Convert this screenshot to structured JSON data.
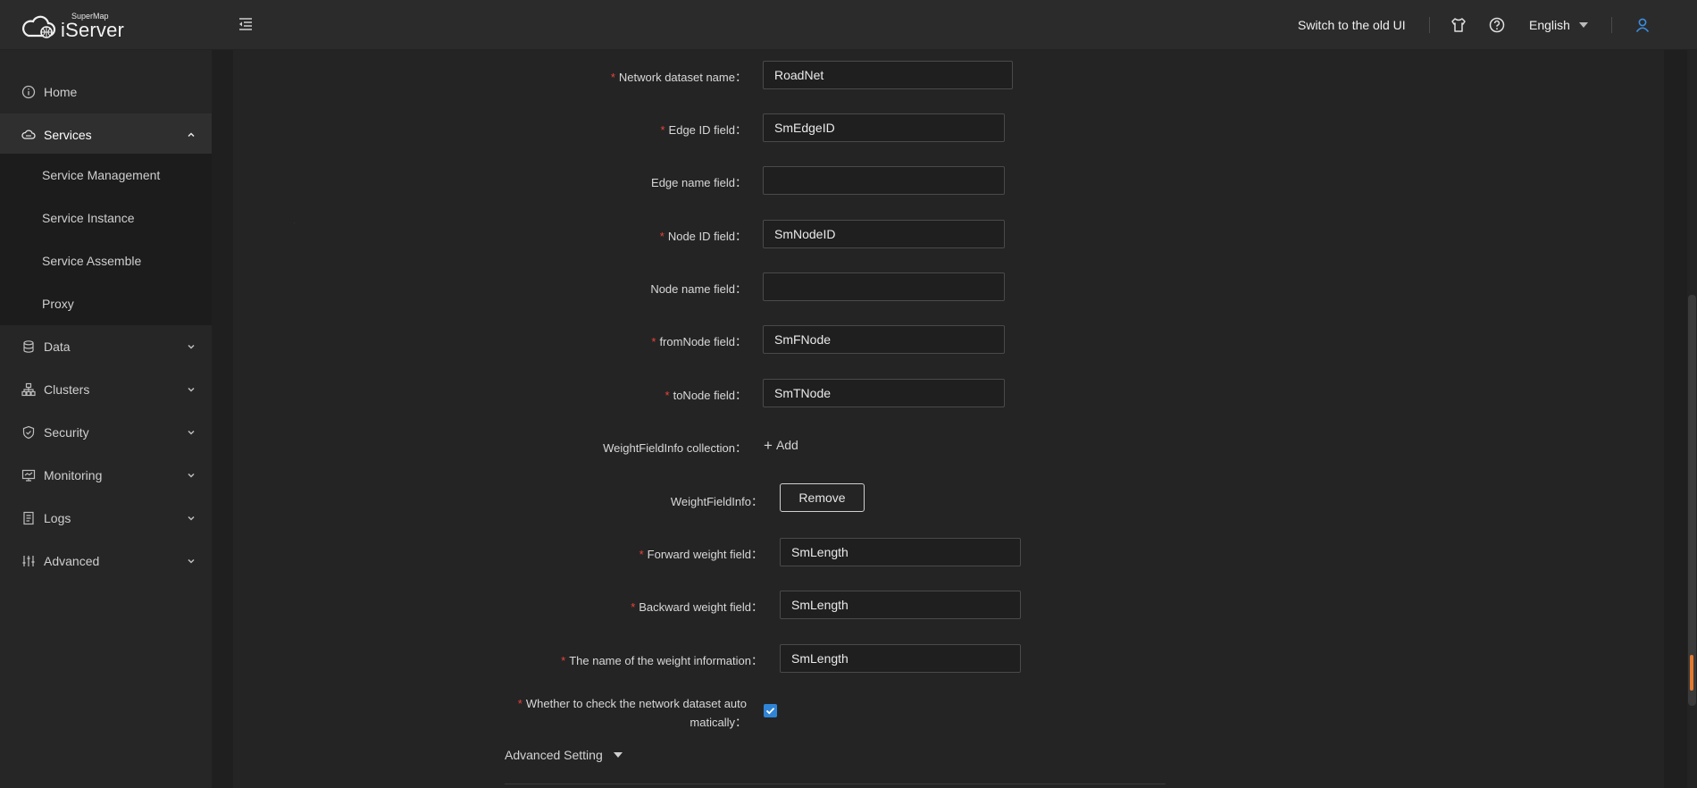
{
  "header": {
    "logo_small": "SuperMap",
    "logo_big": "iServer",
    "old_ui": "Switch to the old UI",
    "language": "English"
  },
  "sidebar": {
    "items": [
      {
        "label": "Home"
      },
      {
        "label": "Services"
      },
      {
        "label": "Data"
      },
      {
        "label": "Clusters"
      },
      {
        "label": "Security"
      },
      {
        "label": "Monitoring"
      },
      {
        "label": "Logs"
      },
      {
        "label": "Advanced"
      }
    ],
    "services_sub": [
      {
        "label": "Service Management"
      },
      {
        "label": "Service Instance"
      },
      {
        "label": "Service Assemble"
      },
      {
        "label": "Proxy"
      }
    ]
  },
  "form": {
    "network_dataset_name": {
      "label": "Network dataset name",
      "value": "RoadNet"
    },
    "edge_id_field": {
      "label": "Edge ID field",
      "value": "SmEdgeID"
    },
    "edge_name_field": {
      "label": "Edge name field",
      "value": ""
    },
    "node_id_field": {
      "label": "Node ID field",
      "value": "SmNodeID"
    },
    "node_name_field": {
      "label": "Node name field",
      "value": ""
    },
    "from_node_field": {
      "label": "fromNode field",
      "value": "SmFNode"
    },
    "to_node_field": {
      "label": "toNode field",
      "value": "SmTNode"
    },
    "weight_collection": {
      "label": "WeightFieldInfo collection",
      "add_label": "Add"
    },
    "weight_info": {
      "label": "WeightFieldInfo",
      "remove_label": "Remove"
    },
    "forward_weight_field": {
      "label": "Forward weight field",
      "value": "SmLength"
    },
    "backward_weight_field": {
      "label": "Backward weight field",
      "value": "SmLength"
    },
    "weight_info_name": {
      "label": "The name of the weight information",
      "value": "SmLength"
    },
    "auto_check": {
      "label_line1": "Whether to check the network dataset auto",
      "label_line2": "matically",
      "checked": true
    },
    "colon": "：",
    "required_mark": "*"
  },
  "advanced_setting": {
    "label": "Advanced Setting"
  },
  "colors": {
    "accent": "#2f84d6",
    "required": "#e8443a",
    "scroll_accent": "#e2792e"
  }
}
